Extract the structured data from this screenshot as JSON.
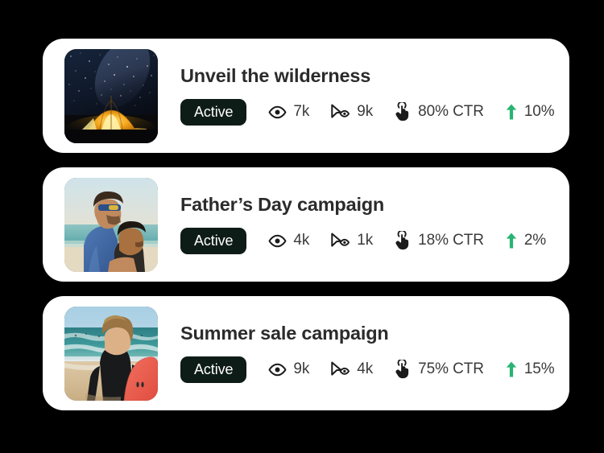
{
  "background_color": "#000000",
  "card_background": "#ffffff",
  "accent_green": "#29b473",
  "badge_background": "#0e1c18",
  "title_color": "#2b2b2b",
  "metric_text_color": "#3b3b3b",
  "cards": [
    {
      "title": "Unveil the wilderness",
      "status": "Active",
      "thumbnail_alt": "night-sky-tent-photo",
      "metrics": {
        "impressions_icon": "eye-icon",
        "impressions": "7k",
        "views_icon": "cursor-eye-icon",
        "views": "9k",
        "ctr_icon": "tap-hand-icon",
        "ctr": "80% CTR",
        "trend_icon": "arrow-up-icon",
        "trend": "10%"
      }
    },
    {
      "title": "Father’s Day campaign",
      "status": "Active",
      "thumbnail_alt": "father-and-son-beach-photo",
      "metrics": {
        "impressions_icon": "eye-icon",
        "impressions": "4k",
        "views_icon": "cursor-eye-icon",
        "views": "1k",
        "ctr_icon": "tap-hand-icon",
        "ctr": "18% CTR",
        "trend_icon": "arrow-up-icon",
        "trend": "2%"
      }
    },
    {
      "title": "Summer sale campaign",
      "status": "Active",
      "thumbnail_alt": "surfer-with-board-beach-photo",
      "metrics": {
        "impressions_icon": "eye-icon",
        "impressions": "9k",
        "views_icon": "cursor-eye-icon",
        "views": "4k",
        "ctr_icon": "tap-hand-icon",
        "ctr": "75% CTR",
        "trend_icon": "arrow-up-icon",
        "trend": "15%"
      }
    }
  ]
}
